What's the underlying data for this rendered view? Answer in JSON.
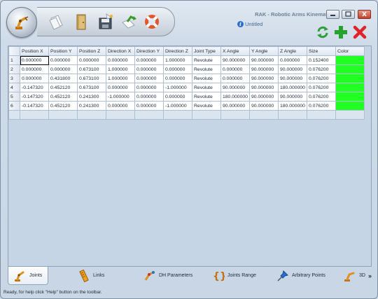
{
  "app": {
    "title": "RAK - Robotic Arms Kinematics",
    "document": "Untitled"
  },
  "quick_access": [
    "new-document-icon",
    "open-folder-icon",
    "save-icon",
    "save-as-icon",
    "help-lifebuoy-icon"
  ],
  "toolbar": [
    "refresh-icon",
    "add-icon",
    "remove-icon"
  ],
  "grid": {
    "columns": [
      "Position X",
      "Position Y",
      "Position Z",
      "Direction X",
      "Direction Y",
      "Direction Z",
      "Joint Type",
      "X Angle",
      "Y Angle",
      "Z Angle",
      "Size",
      "Color"
    ],
    "rows": [
      {
        "index": "1",
        "cells": [
          "0.000000",
          "0.000000",
          "0.000000",
          "0.000000",
          "0.000000",
          "1.000000",
          "Revolute",
          "90.000000",
          "90.000000",
          "0.000000",
          "0.152400"
        ],
        "color": "#22ff22"
      },
      {
        "index": "2",
        "cells": [
          "0.000000",
          "0.000000",
          "0.673100",
          "1.000000",
          "0.000000",
          "0.000000",
          "Revolute",
          "0.000000",
          "90.000000",
          "90.000000",
          "0.076200"
        ],
        "color": "#22ff22"
      },
      {
        "index": "3",
        "cells": [
          "0.000000",
          "0.431800",
          "0.673100",
          "1.000000",
          "0.000000",
          "0.000000",
          "Revolute",
          "0.000000",
          "90.000000",
          "90.000000",
          "0.076200"
        ],
        "color": "#22ff22"
      },
      {
        "index": "4",
        "cells": [
          "-0.147320",
          "0.452120",
          "0.673100",
          "0.000000",
          "0.000000",
          "-1.000000",
          "Revolute",
          "90.000000",
          "90.000000",
          "180.000000",
          "0.076200"
        ],
        "color": "#22ff22"
      },
      {
        "index": "5",
        "cells": [
          "-0.147320",
          "0.452120",
          "0.241300",
          "-1.000000",
          "0.000000",
          "0.000000",
          "Revolute",
          "180.000000",
          "90.000000",
          "90.000000",
          "0.076200"
        ],
        "color": "#22ff22"
      },
      {
        "index": "6",
        "cells": [
          "-0.147320",
          "0.452120",
          "0.241300",
          "0.000000",
          "0.000000",
          "-1.000000",
          "Revolute",
          "90.000000",
          "90.000000",
          "180.000000",
          "0.076200"
        ],
        "color": "#22ff22"
      }
    ]
  },
  "tabs": [
    {
      "label": "Joints",
      "icon": "robot-arm-icon",
      "active": true
    },
    {
      "label": "Links",
      "icon": "link-ruler-icon",
      "active": false
    },
    {
      "label": "DH Parameters",
      "icon": "dh-parameters-icon",
      "active": false
    },
    {
      "label": "Joints Range",
      "icon": "braces-icon",
      "active": false
    },
    {
      "label": "Arbitrary Points",
      "icon": "pushpin-icon",
      "active": false
    },
    {
      "label": "3D",
      "icon": "robot-3d-icon",
      "active": false
    }
  ],
  "more_tabs": "»",
  "status": "Ready, for help click \"Help\" button on the toolbar."
}
